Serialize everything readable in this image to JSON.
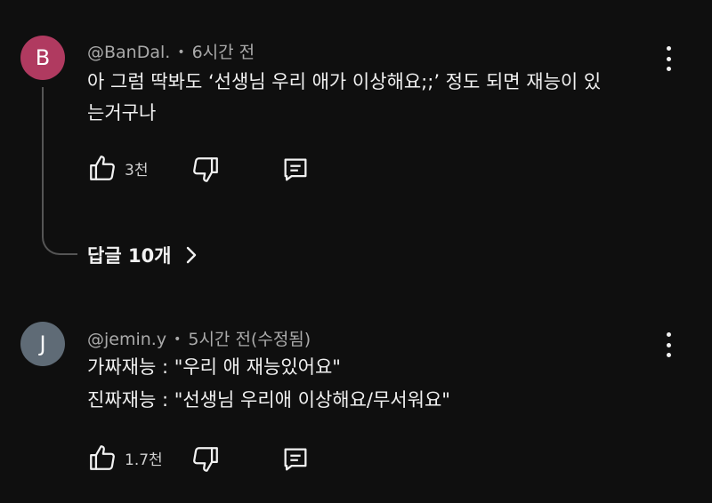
{
  "comments": [
    {
      "avatar_letter": "B",
      "avatar_color": "#b03a60",
      "handle": "@BanDal.",
      "time": "6시간 전",
      "lines": [
        "아 그럼 딱봐도 ‘선생님 우리 애가 이상해요;;’ 정도 되면 재능이 있",
        "는거구나"
      ],
      "likes": "3천",
      "replies_label": "답글 10개"
    },
    {
      "avatar_letter": "J",
      "avatar_color": "#5f6b76",
      "handle": "@jemin.y",
      "time": "5시간 전(수정됨)",
      "lines": [
        "가짜재능 : \"우리 애 재능있어요\"",
        "진짜재능 : \"선생님 우리애 이상해요/무서워요\""
      ],
      "likes": "1.7천"
    }
  ],
  "icons": [
    "like-icon",
    "dislike-icon",
    "reply-icon",
    "more-vert-icon",
    "chevron-right-icon"
  ]
}
